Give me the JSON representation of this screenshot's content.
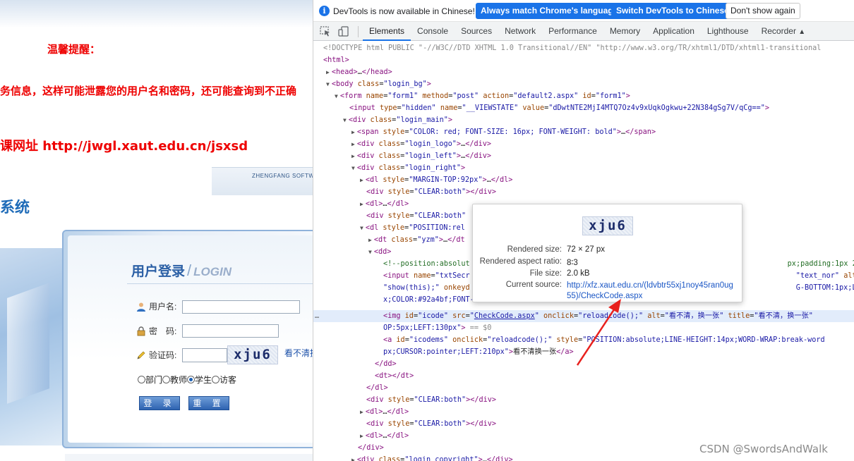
{
  "page": {
    "reminder": "温馨提醒：",
    "warning_text": "务信息，这样可能泄露您的用户名和密码，还可能查询到不正确",
    "course_text": "课网址 http://jwgl.xaut.edu.cn/jsxsd",
    "vendor_text": "ZHENGFANG SOFTW",
    "system_title": "系统",
    "login": {
      "title_zh": "用户登录",
      "title_sep": "/",
      "title_en": "LOGIN",
      "username_label": "用户名:",
      "password_label": "密　码:",
      "captcha_label": "验证码:",
      "captcha_text": "xju6",
      "captcha_refresh": "看不清换一张",
      "roles": [
        "部门",
        "教师",
        "学生",
        "访客"
      ],
      "selected_role": "学生",
      "login_button": "登 录",
      "reset_button": "重 置"
    }
  },
  "devtools": {
    "infobar": {
      "message": "DevTools is now available in Chinese!",
      "btn_match": "Always match Chrome's language",
      "btn_switch": "Switch DevTools to Chinese",
      "btn_dismiss": "Don't show again"
    },
    "tabs": [
      "Elements",
      "Console",
      "Sources",
      "Network",
      "Performance",
      "Memory",
      "Application",
      "Lighthouse",
      "Recorder"
    ],
    "active_tab": "Elements",
    "tooltip": {
      "rendered_size_label": "Rendered size:",
      "rendered_size": "72 × 27 px",
      "aspect_label": "Rendered aspect ratio:",
      "aspect": "8∶3",
      "file_size_label": "File size:",
      "file_size": "2.0 kB",
      "source_label": "Current source:",
      "source": "http://xfz.xaut.edu.cn/(ldvbtr55xj1noy45ran0ug55)/CheckCode.aspx"
    }
  },
  "watermark": "CSDN @SwordsAndWalk"
}
